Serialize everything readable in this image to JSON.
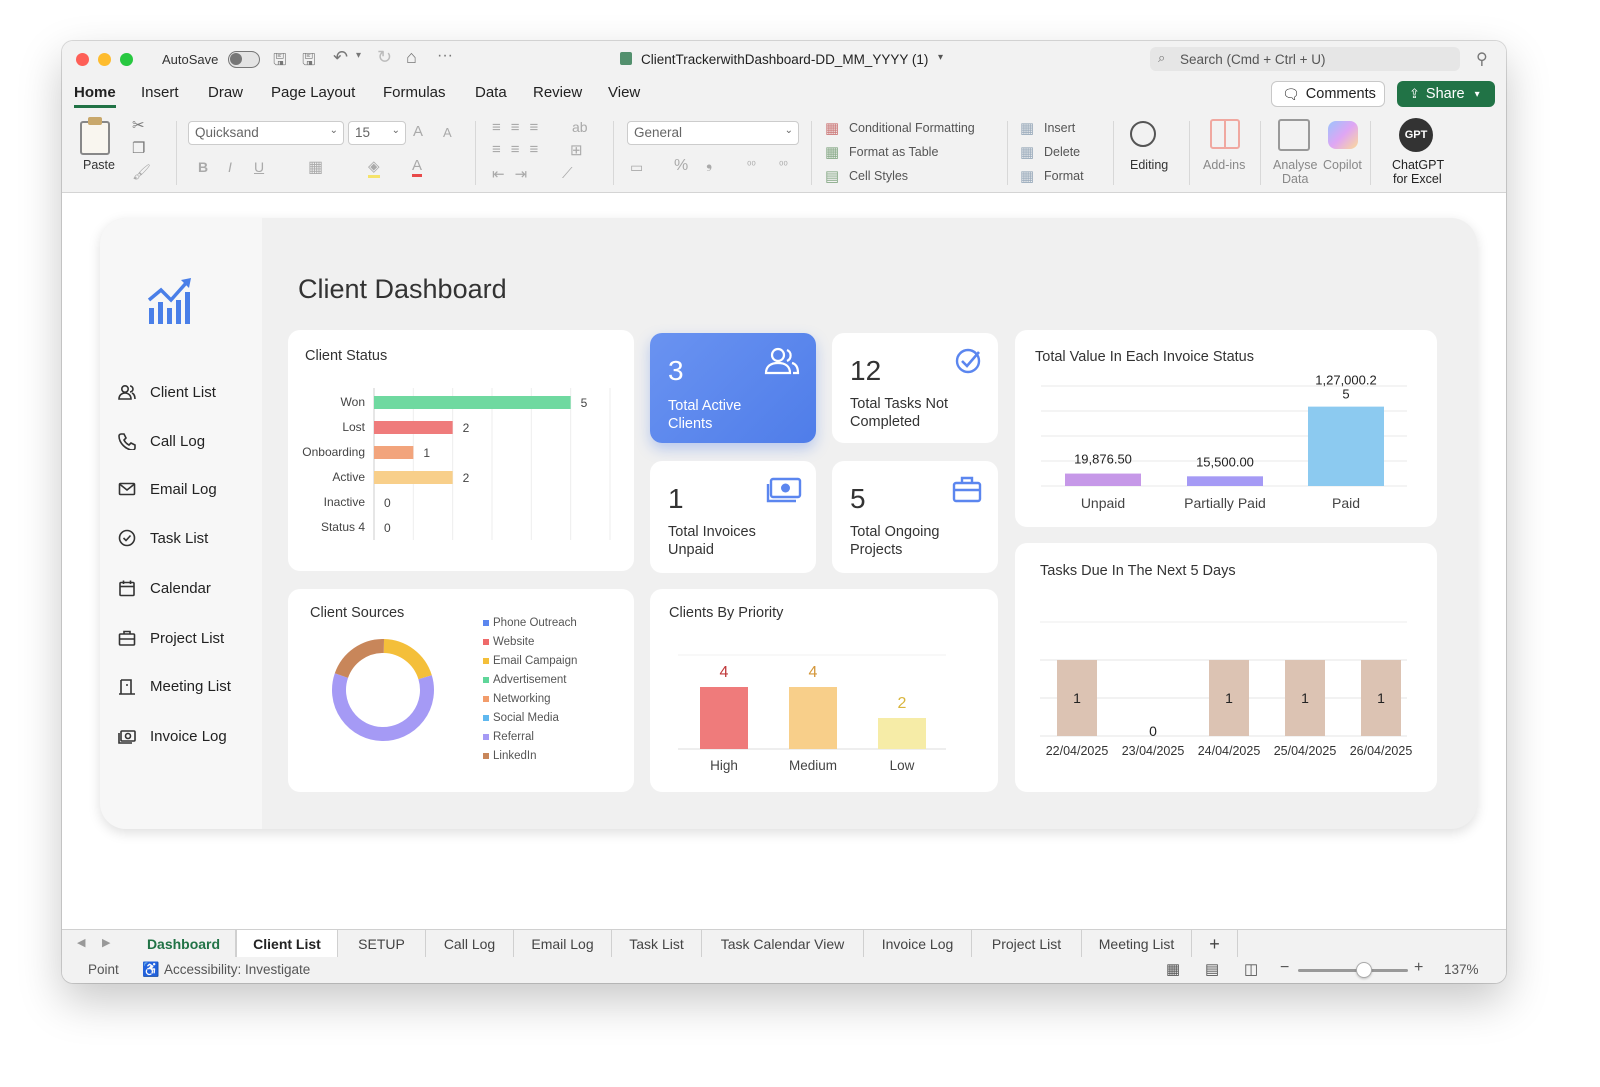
{
  "window": {
    "autosave_label": "AutoSave",
    "title": "ClientTrackerwithDashboard-DD_MM_YYYY (1)",
    "search_placeholder": "Search (Cmd + Ctrl + U)"
  },
  "ribbon": {
    "tabs": [
      "Home",
      "Insert",
      "Draw",
      "Page Layout",
      "Formulas",
      "Data",
      "Review",
      "View"
    ],
    "active_tab": "Home",
    "comments_label": "Comments",
    "share_label": "Share",
    "paste_label": "Paste",
    "font_name": "Quicksand",
    "font_size": "15",
    "number_format": "General",
    "conditional_formatting": "Conditional Formatting",
    "format_as_table": "Format as Table",
    "cell_styles": "Cell Styles",
    "insert": "Insert",
    "delete": "Delete",
    "format": "Format",
    "editing": "Editing",
    "addins": "Add-ins",
    "analyse_data_1": "Analyse",
    "analyse_data_2": "Data",
    "copilot": "Copilot",
    "gpt_badge": "GPT",
    "chatgpt_1": "ChatGPT",
    "chatgpt_2": "for Excel"
  },
  "dashboard": {
    "title": "Client Dashboard",
    "nav": [
      "Client List",
      "Call Log",
      "Email Log",
      "Task List",
      "Calendar",
      "Project List",
      "Meeting List",
      "Invoice Log"
    ],
    "kpis": {
      "active_clients": {
        "value": "3",
        "label1": "Total Active",
        "label2": "Clients"
      },
      "tasks_not_completed": {
        "value": "12",
        "label1": "Total Tasks Not",
        "label2": "Completed"
      },
      "invoices_unpaid": {
        "value": "1",
        "label1": "Total Invoices",
        "label2": "Unpaid"
      },
      "ongoing_projects": {
        "value": "5",
        "label1": "Total Ongoing",
        "label2": "Projects"
      }
    },
    "colors": {
      "accent_blue": "#5b86ef",
      "won": "#6fd9a0",
      "lost": "#ef7b7b",
      "onboarding": "#f2a47c",
      "active": "#f8cf8a"
    }
  },
  "chart_data": [
    {
      "id": "client_status",
      "type": "bar",
      "orientation": "horizontal",
      "title": "Client Status",
      "categories": [
        "Won",
        "Lost",
        "Onboarding",
        "Active",
        "Inactive",
        "Status 4"
      ],
      "values": [
        5,
        2,
        1,
        2,
        0,
        0
      ],
      "colors": [
        "#6fd9a0",
        "#ef7b7b",
        "#f2a47c",
        "#f8cf8a",
        "#cccccc",
        "#cccccc"
      ],
      "xlim": [
        0,
        6
      ],
      "grid": true
    },
    {
      "id": "invoice_status",
      "type": "bar",
      "title": "Total Value In Each Invoice Status",
      "categories": [
        "Unpaid",
        "Partially Paid",
        "Paid"
      ],
      "values": [
        19876.5,
        15500,
        127000.25
      ],
      "labels": [
        "19,876.50",
        "15,500.00",
        "1,27,000.2",
        "5"
      ],
      "colors": [
        "#c698e8",
        "#a59af5",
        "#8ccaf0"
      ],
      "ylim": [
        0,
        160000
      ],
      "grid": true
    },
    {
      "id": "client_sources",
      "type": "pie",
      "title": "Client Sources",
      "labels": [
        "Phone Outreach",
        "Website",
        "Email Campaign",
        "Advertisement",
        "Networking",
        "Social Media",
        "Referral",
        "LinkedIn"
      ],
      "legend_colors": [
        "#5b86ef",
        "#ef6a6a",
        "#f4bf3a",
        "#5fd69a",
        "#f29c6b",
        "#5fb8ef",
        "#a59af5",
        "#c8865a"
      ],
      "values": [
        0,
        0,
        1,
        0,
        0,
        0,
        3,
        1
      ],
      "legend": "right"
    },
    {
      "id": "clients_by_priority",
      "type": "bar",
      "title": "Clients By Priority",
      "categories": [
        "High",
        "Medium",
        "Low"
      ],
      "values": [
        4,
        4,
        2
      ],
      "colors": [
        "#ef7b7b",
        "#f8cf8a",
        "#f6eca7"
      ],
      "label_colors": [
        "#c0393b",
        "#d4973a",
        "#d9b53d"
      ],
      "ylim": [
        0,
        5
      ]
    },
    {
      "id": "tasks_due",
      "type": "bar",
      "title": "Tasks Due In The Next 5 Days",
      "categories": [
        "22/04/2025",
        "23/04/2025",
        "24/04/2025",
        "25/04/2025",
        "26/04/2025"
      ],
      "values": [
        1,
        0,
        1,
        1,
        1
      ],
      "color": "#dcc3b3",
      "ylim": [
        0,
        1.3
      ],
      "grid": true
    }
  ],
  "sheet_tabs": [
    "Dashboard",
    "Client List",
    "SETUP",
    "Call Log",
    "Email Log",
    "Task List",
    "Task Calendar View",
    "Invoice Log",
    "Project List",
    "Meeting List"
  ],
  "active_sheet": "Client List",
  "status_bar": {
    "mode": "Point",
    "accessibility": "Accessibility: Investigate",
    "zoom": "137%",
    "zoom_level": 0.6
  }
}
